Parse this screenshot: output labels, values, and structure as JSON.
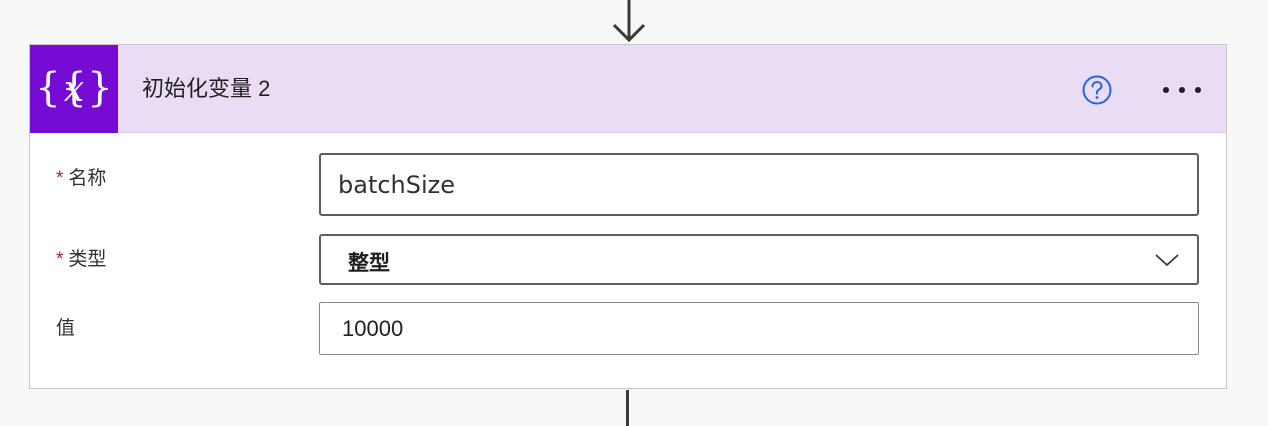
{
  "colors": {
    "header_background": "#ebdcf6",
    "icon_background": "#770bd6",
    "help_icon": "#2266e3",
    "required_marker": "#a4262c",
    "canvas_background": "#f8f8f8"
  },
  "icons": {
    "connector_top": "arrow-down-icon",
    "action_icon": "variable-icon",
    "help": "question-circle-icon",
    "more": "ellipsis-icon",
    "dropdown": "chevron-down-icon"
  },
  "card": {
    "title": "初始化变量 2",
    "fields": {
      "name": {
        "required_marker": "*",
        "label": "名称",
        "value": "batchSize"
      },
      "type": {
        "required_marker": "*",
        "label": "类型",
        "selected": "整型"
      },
      "value": {
        "label": "值",
        "value": "10000"
      }
    }
  }
}
